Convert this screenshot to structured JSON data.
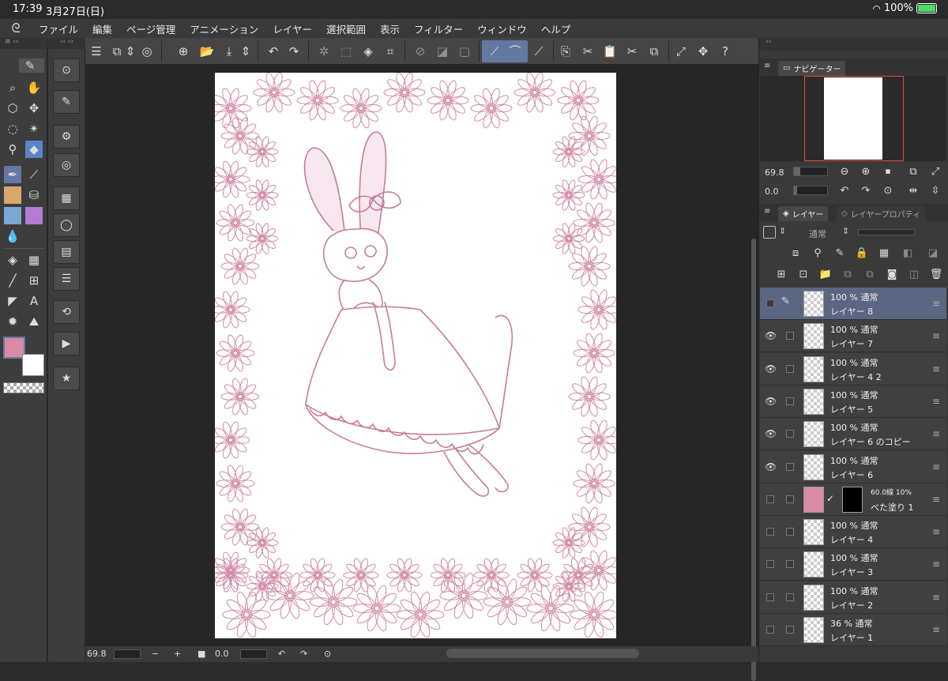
{
  "status": {
    "time": "17:39",
    "date": "3月27日(日)",
    "battery": "100%",
    "battery_level": 1.0
  },
  "menu": {
    "items": [
      "ファイル",
      "編集",
      "ページ管理",
      "アニメーション",
      "レイヤー",
      "選択範囲",
      "表示",
      "フィルター",
      "ウィンドウ",
      "ヘルプ"
    ]
  },
  "navigator": {
    "title": "ナビゲーター",
    "zoom": "69.8",
    "rotation": "0.0"
  },
  "bottombar": {
    "zoom": "69.8",
    "rotation": "0.0"
  },
  "layers_panel": {
    "tab_layer": "レイヤー",
    "tab_property": "レイヤープロパティ",
    "blend_mode": "通常",
    "layers": [
      {
        "mode": "100 % 通常",
        "name": "レイヤー 8",
        "selected": true,
        "visible": false
      },
      {
        "mode": "100 % 通常",
        "name": "レイヤー 7",
        "visible": true
      },
      {
        "mode": "100 % 通常",
        "name": "レイヤー 4 2",
        "visible": true
      },
      {
        "mode": "100 % 通常",
        "name": "レイヤー 5",
        "visible": true
      },
      {
        "mode": "100 % 通常",
        "name": "レイヤー 6 のコピー",
        "visible": true
      },
      {
        "mode": "100 % 通常",
        "name": "レイヤー 6",
        "visible": true
      },
      {
        "mode": "60.0線 10%",
        "name": "べた塗り 1",
        "visible": false,
        "fill": true
      },
      {
        "mode": "100 % 通常",
        "name": "レイヤー 4",
        "visible": false
      },
      {
        "mode": "100 % 通常",
        "name": "レイヤー 3",
        "visible": false
      },
      {
        "mode": "100 % 通常",
        "name": "レイヤー 2",
        "visible": false
      },
      {
        "mode": "36 % 通常",
        "name": "レイヤー 1",
        "visible": false
      }
    ]
  },
  "colors": {
    "main": "#d98aa6",
    "sub": "#ffffff",
    "line": "#d08aa5"
  }
}
